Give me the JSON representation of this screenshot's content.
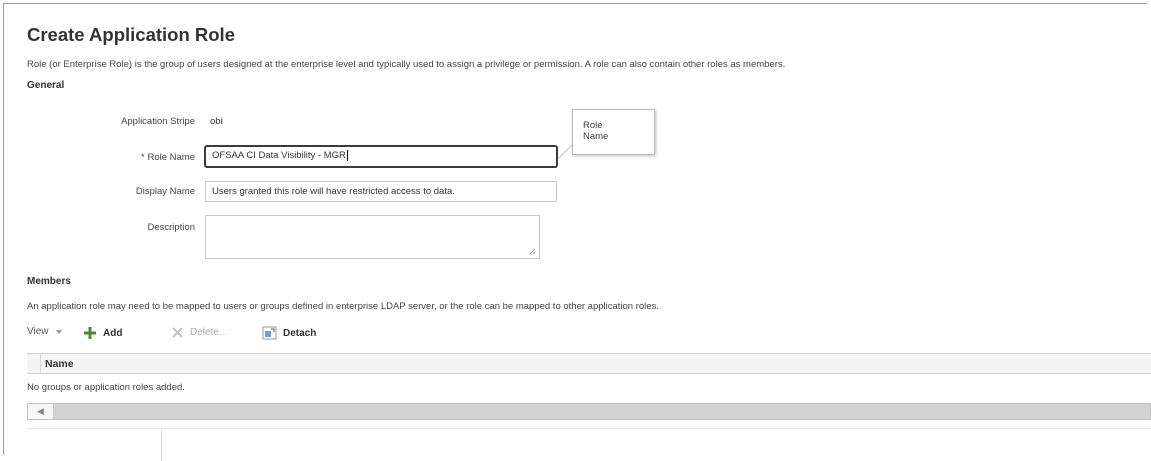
{
  "page": {
    "title": "Create Application Role",
    "intro": "Role (or Enterprise Role) is the group of users designed at the enterprise level and typically used to assign a privilege or permission. A role can also contain other roles as members."
  },
  "general": {
    "heading": "General",
    "app_stripe_label": "Application Stripe",
    "app_stripe_value": "obi",
    "role_name_required": "*",
    "role_name_label": "Role Name",
    "role_name_value": "OFSAA CI Data Visibility - MGR",
    "display_name_label": "Display Name",
    "display_name_value": "Users granted this role will have restricted access to data.",
    "description_label": "Description",
    "description_value": ""
  },
  "tooltip": {
    "line1": "Role",
    "line2": "Name"
  },
  "members": {
    "heading": "Members",
    "info": "An application role may need to be mapped to users or groups defined in enterprise LDAP server, or the role can be mapped to other application roles.",
    "toolbar": {
      "view": "View",
      "add": "Add",
      "delete": "Delete...",
      "detach": "Detach"
    },
    "columns": [
      "Name"
    ],
    "empty_message": "No groups or application roles added."
  },
  "icons": {
    "view_menu": "chevron-down-icon",
    "add": "plus-icon",
    "delete": "delete-x-icon",
    "detach": "detach-icon",
    "scroll_left": "scroll-left-arrow-icon"
  },
  "colors": {
    "add_icon": "#4a8a2a",
    "scrollbar": "#d3d3d3"
  }
}
